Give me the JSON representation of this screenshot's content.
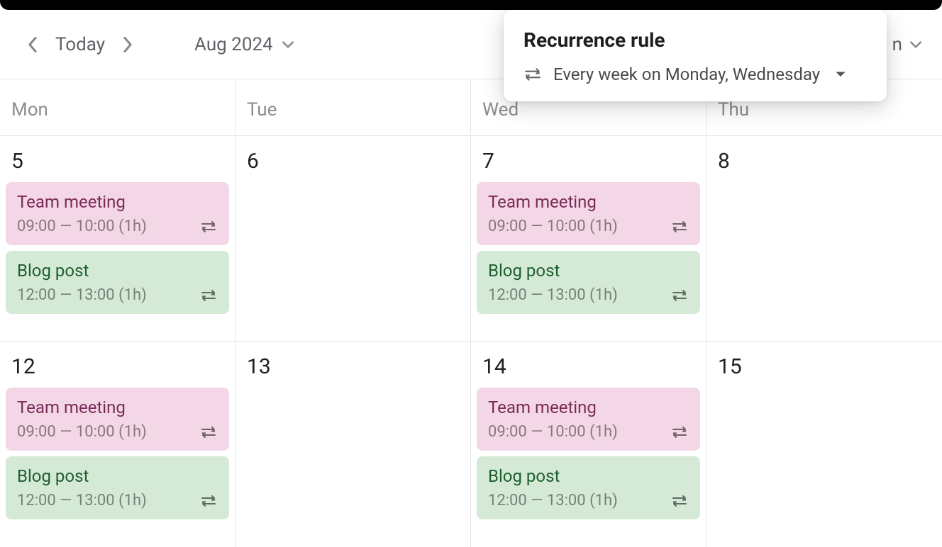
{
  "toolbar": {
    "today_label": "Today",
    "month_label": "Aug 2024",
    "right_visible_text": "n"
  },
  "popover": {
    "title": "Recurrence rule",
    "rule_text": "Every week on Monday, Wednesday"
  },
  "day_headers": [
    "Mon",
    "Tue",
    "Wed",
    "Thu"
  ],
  "weeks": [
    {
      "dates": [
        "5",
        "6",
        "7",
        "8"
      ],
      "events": [
        [
          {
            "title": "Team meeting",
            "time": "09:00 — 10:00 (1h)",
            "color": "pink"
          },
          {
            "title": "Blog post",
            "time": "12:00 — 13:00 (1h)",
            "color": "green"
          }
        ],
        [],
        [
          {
            "title": "Team meeting",
            "time": "09:00 — 10:00 (1h)",
            "color": "pink"
          },
          {
            "title": "Blog post",
            "time": "12:00 — 13:00 (1h)",
            "color": "green"
          }
        ],
        []
      ]
    },
    {
      "dates": [
        "12",
        "13",
        "14",
        "15"
      ],
      "events": [
        [
          {
            "title": "Team meeting",
            "time": "09:00 — 10:00 (1h)",
            "color": "pink"
          },
          {
            "title": "Blog post",
            "time": "12:00 — 13:00 (1h)",
            "color": "green"
          }
        ],
        [],
        [
          {
            "title": "Team meeting",
            "time": "09:00 — 10:00 (1h)",
            "color": "pink"
          },
          {
            "title": "Blog post",
            "time": "12:00 — 13:00 (1h)",
            "color": "green"
          }
        ],
        []
      ]
    }
  ]
}
